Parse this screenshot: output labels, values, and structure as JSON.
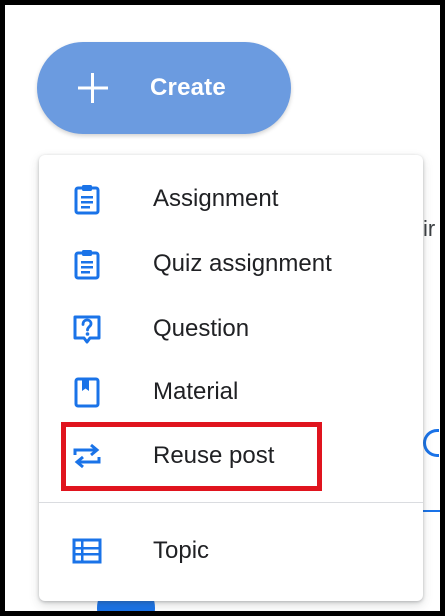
{
  "create_button": {
    "label": "Create",
    "icon": "plus-icon",
    "color": "#6b9be0"
  },
  "menu": {
    "items": [
      {
        "label": "Assignment",
        "icon": "assignment-icon"
      },
      {
        "label": "Quiz assignment",
        "icon": "quiz-assignment-icon"
      },
      {
        "label": "Question",
        "icon": "question-icon"
      },
      {
        "label": "Material",
        "icon": "material-icon"
      },
      {
        "label": "Reuse post",
        "icon": "reuse-post-icon",
        "highlighted": true
      },
      {
        "label": "Topic",
        "icon": "topic-icon"
      }
    ],
    "icon_color": "#1a73e8",
    "highlight_color": "#e0141e"
  },
  "background": {
    "partial_text": "ir"
  }
}
